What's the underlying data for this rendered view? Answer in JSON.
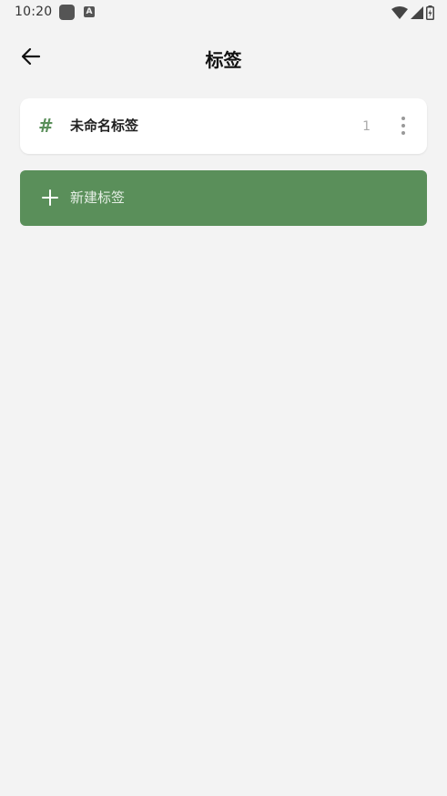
{
  "status_bar": {
    "time": "10:20",
    "icons": [
      "notification-square-icon",
      "a-app-icon",
      "wifi-icon",
      "signal-icon",
      "battery-icon"
    ]
  },
  "app_bar": {
    "title": "标签",
    "back_icon": "arrow-left-icon"
  },
  "tags": [
    {
      "symbol": "#",
      "name": "未命名标签",
      "count": "1",
      "menu_icon": "more-vertical-icon"
    }
  ],
  "new_tag": {
    "icon": "plus-icon",
    "label": "新建标签"
  },
  "colors": {
    "background": "#f3f3f3",
    "accent": "#5a8f5a",
    "card": "#ffffff"
  }
}
